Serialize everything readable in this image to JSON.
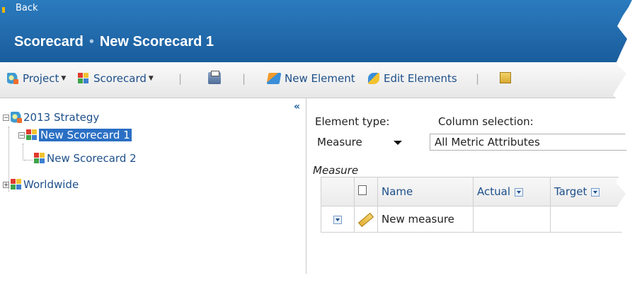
{
  "header": {
    "back_label": "Back",
    "title_part1": "Scorecard",
    "title_separator": "•",
    "title_part2": "New Scorecard 1"
  },
  "toolbar": {
    "project_label": "Project",
    "scorecard_label": "Scorecard",
    "separator": "|",
    "new_element_label": "New Element",
    "edit_elements_label": "Edit Elements"
  },
  "tree": {
    "collapse_glyph": "«",
    "nodes": [
      {
        "label": "2013 Strategy",
        "expander": "−"
      },
      {
        "label": "New Scorecard 1",
        "expander": "−",
        "selected": true
      },
      {
        "label": "New Scorecard 2"
      },
      {
        "label": "Worldwide",
        "expander": "+"
      }
    ]
  },
  "editor": {
    "element_type_label": "Element type:",
    "element_type_value": "Measure",
    "column_selection_label": "Column selection:",
    "column_selection_value": "All Metric Attributes",
    "section_title": "Measure",
    "columns": [
      "",
      "",
      "Name",
      "Actual",
      "Target"
    ],
    "rows": [
      {
        "name": "New measure",
        "actual": "",
        "target": ""
      }
    ]
  },
  "colors": {
    "header_blue": "#1f68ad",
    "selection_blue": "#2a6fc4",
    "link_blue": "#1d4f8a"
  }
}
